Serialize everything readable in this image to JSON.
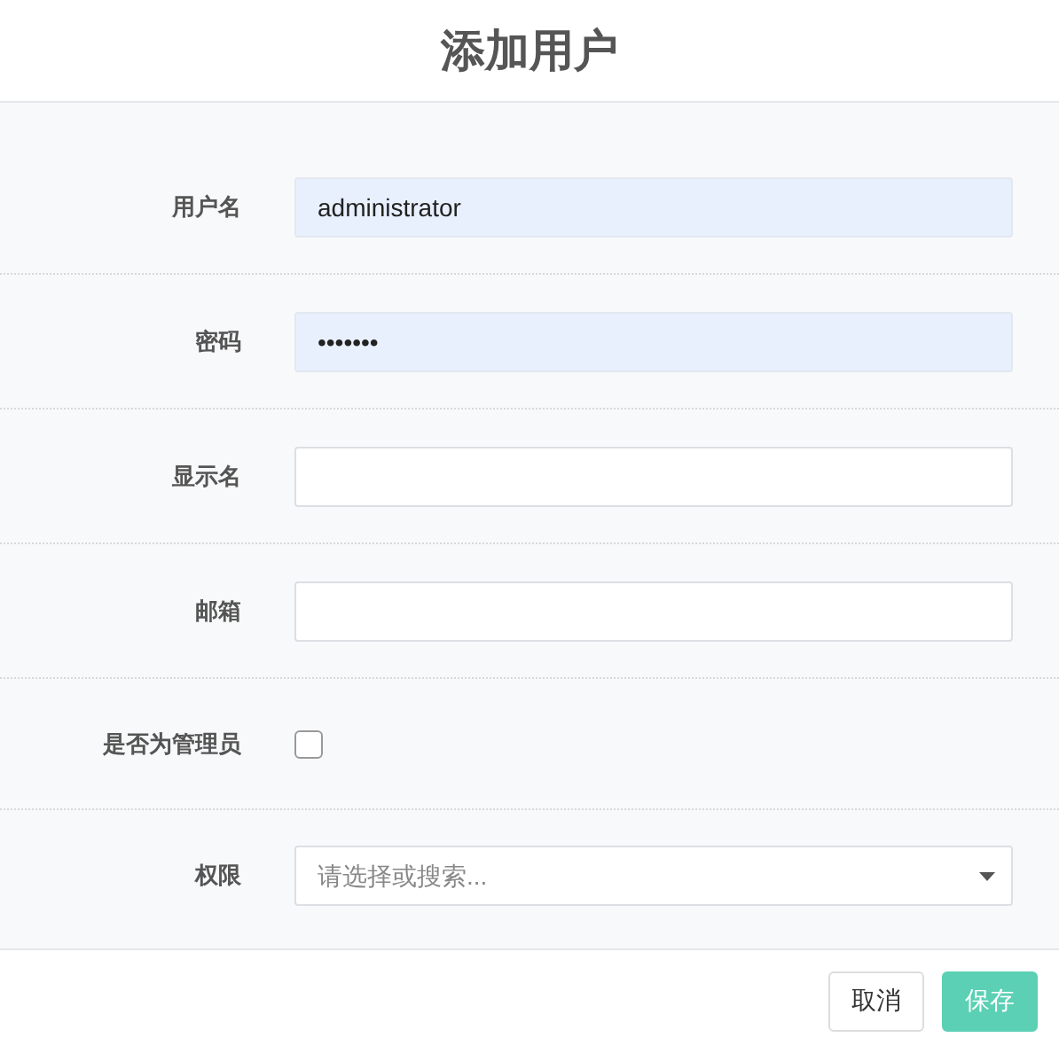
{
  "dialog": {
    "title": "添加用户"
  },
  "fields": [
    {
      "kind": "text",
      "label": "用户名",
      "value": "administrator",
      "autofilled": true
    },
    {
      "kind": "password",
      "label": "密码",
      "value": "•••••••",
      "autofilled": true
    },
    {
      "kind": "text",
      "label": "显示名",
      "autofilled": false
    },
    {
      "kind": "text",
      "label": "邮箱",
      "autofilled": false
    },
    {
      "kind": "checkbox",
      "label": "是否为管理员",
      "checked": false
    },
    {
      "kind": "select",
      "label": "权限",
      "placeholder": "请选择或搜索..."
    }
  ],
  "buttons": [
    {
      "kind": "secondary",
      "label": "取消"
    },
    {
      "kind": "primary",
      "label": "保存"
    }
  ]
}
